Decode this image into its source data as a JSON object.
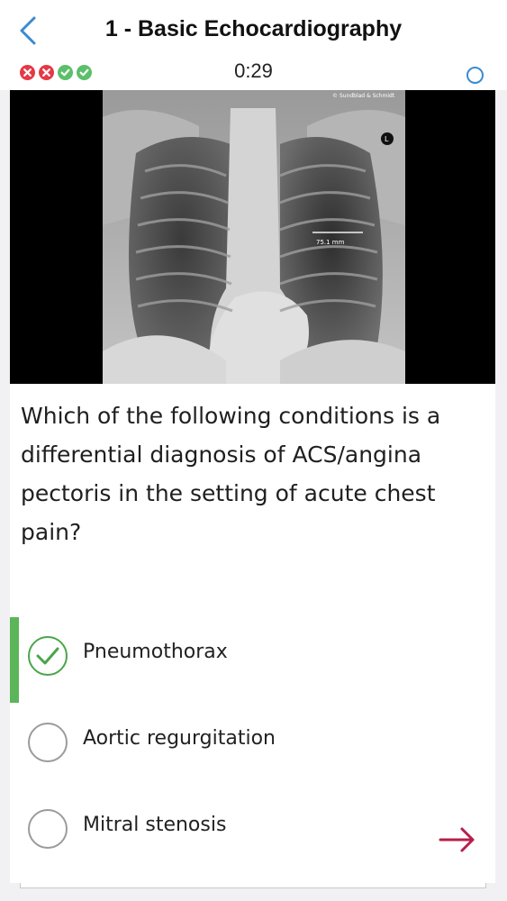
{
  "header": {
    "title": "1 - Basic Echocardiography",
    "timer": "0:29",
    "progress": [
      {
        "status": "wrong",
        "icon": "x-icon",
        "color": "#e53946"
      },
      {
        "status": "wrong",
        "icon": "x-icon",
        "color": "#e53946"
      },
      {
        "status": "correct",
        "icon": "check-icon",
        "color": "#5cbf6a"
      },
      {
        "status": "correct",
        "icon": "check-icon",
        "color": "#5cbf6a"
      }
    ]
  },
  "image": {
    "copyright": "© Sundblad & Schmidt",
    "side_marker": "L",
    "measurement": "75.1 mm"
  },
  "question": {
    "text": "Which of the following conditions is a differential diagnosis of ACS/angina pectoris in the setting of acute chest pain?"
  },
  "answers": [
    {
      "label": "Pneumothorax",
      "state": "correct"
    },
    {
      "label": "Aortic regurgitation",
      "state": "unselected"
    },
    {
      "label": "Mitral stenosis",
      "state": "unselected"
    }
  ],
  "colors": {
    "accent_blue": "#3a8bd0",
    "correct_green": "#5db55a",
    "wrong_red": "#e53946",
    "next_arrow": "#b81d4a"
  }
}
